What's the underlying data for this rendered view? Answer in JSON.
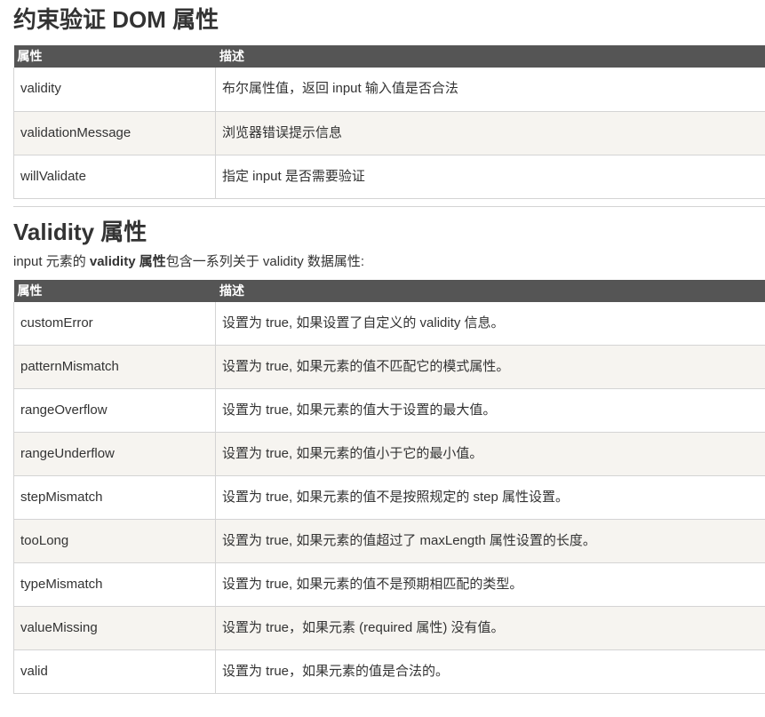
{
  "section1": {
    "title": "约束验证 DOM 属性",
    "headers": [
      "属性",
      "描述"
    ],
    "rows": [
      {
        "name": "validity",
        "desc": "布尔属性值，返回 input 输入值是否合法"
      },
      {
        "name": "validationMessage",
        "desc": "浏览器错误提示信息"
      },
      {
        "name": "willValidate",
        "desc": "指定 input 是否需要验证"
      }
    ]
  },
  "section2": {
    "title": "Validity 属性",
    "intro_prefix": "input 元素的 ",
    "intro_bold": "validity 属性",
    "intro_suffix": "包含一系列关于 validity 数据属性:",
    "headers": [
      "属性",
      "描述"
    ],
    "rows": [
      {
        "name": "customError",
        "desc": "设置为 true, 如果设置了自定义的 validity 信息。"
      },
      {
        "name": "patternMismatch",
        "desc": "设置为 true, 如果元素的值不匹配它的模式属性。"
      },
      {
        "name": "rangeOverflow",
        "desc": "设置为 true, 如果元素的值大于设置的最大值。"
      },
      {
        "name": "rangeUnderflow",
        "desc": "设置为 true, 如果元素的值小于它的最小值。"
      },
      {
        "name": "stepMismatch",
        "desc": "设置为 true, 如果元素的值不是按照规定的 step 属性设置。"
      },
      {
        "name": "tooLong",
        "desc": "设置为 true, 如果元素的值超过了 maxLength 属性设置的长度。"
      },
      {
        "name": "typeMismatch",
        "desc": "设置为 true, 如果元素的值不是预期相匹配的类型。"
      },
      {
        "name": "valueMissing",
        "desc": "设置为 true，如果元素 (required 属性) 没有值。"
      },
      {
        "name": "valid",
        "desc": "设置为 true，如果元素的值是合法的。"
      }
    ]
  }
}
